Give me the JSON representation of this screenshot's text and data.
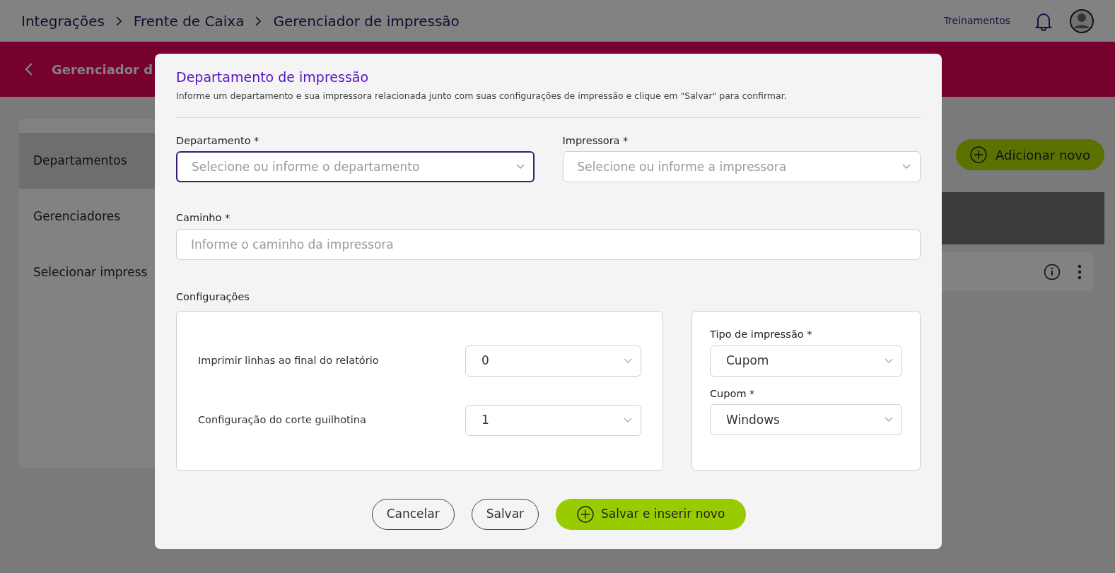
{
  "topbar": {
    "breadcrumb": [
      {
        "label": "Integrações"
      },
      {
        "label": "Frente de Caixa"
      },
      {
        "label": "Gerenciador de impressão"
      }
    ],
    "link": "Treinamentos"
  },
  "page_header": {
    "title": "Gerenciador d"
  },
  "sidebar": {
    "items": [
      {
        "label": "Departamentos",
        "selected": true
      },
      {
        "label": "Gerenciadores",
        "selected": false
      },
      {
        "label": "Selecionar impress",
        "selected": false
      }
    ]
  },
  "toolbar": {
    "add_button": "Adicionar novo"
  },
  "modal": {
    "title": "Departamento de impressão",
    "description": "Informe um departamento e sua impressora relacionada junto com suas configurações de impressão e clique em \"Salvar\" para confirmar.",
    "fields": [
      {
        "label": "Departamento *",
        "placeholder": "Selecione ou informe o departamento",
        "kind": "select",
        "focused": true
      },
      {
        "label": "Impressora *",
        "placeholder": "Selecione ou informe a impressora",
        "kind": "select",
        "focused": false
      },
      {
        "label": "Caminho *",
        "placeholder": "Informe o caminho da impressora",
        "kind": "text",
        "focused": false
      }
    ],
    "settings": {
      "title": "Configurações",
      "rows": [
        {
          "label": "Imprimir linhas ao final do relatório",
          "value": "0"
        },
        {
          "label": "Configuração do corte guilhotina",
          "value": "1"
        }
      ],
      "side": [
        {
          "label": "Tipo de impressão *",
          "value": "Cupom"
        },
        {
          "label": "Cupom *",
          "value": "Windows"
        }
      ]
    },
    "buttons": [
      {
        "label": "Cancelar",
        "kind": "outline"
      },
      {
        "label": "Salvar",
        "kind": "outline"
      },
      {
        "label": "Salvar e inserir novo",
        "kind": "primary"
      }
    ]
  }
}
